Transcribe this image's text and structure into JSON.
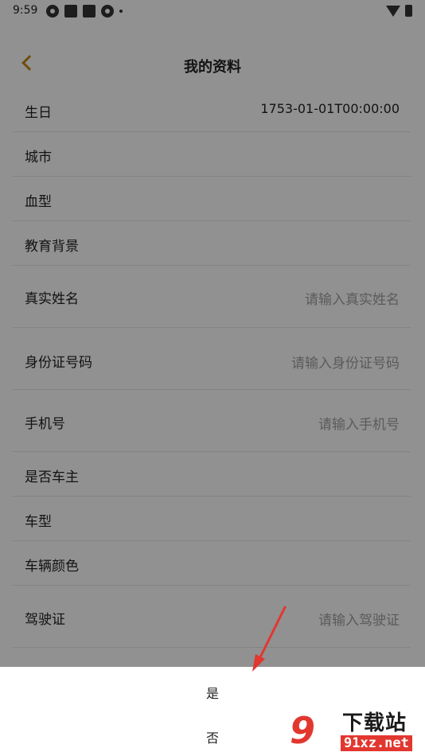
{
  "status_bar": {
    "time": "9:59"
  },
  "header": {
    "title": "我的资料"
  },
  "rows": [
    {
      "label": "生日",
      "value": "1753-01-01T00:00:00",
      "placeholder": ""
    },
    {
      "label": "城市",
      "value": "",
      "placeholder": ""
    },
    {
      "label": "血型",
      "value": "",
      "placeholder": ""
    },
    {
      "label": "教育背景",
      "value": "",
      "placeholder": ""
    },
    {
      "label": "真实姓名",
      "value": "",
      "placeholder": "请输入真实姓名"
    },
    {
      "label": "身份证号码",
      "value": "",
      "placeholder": "请输入身份证号码"
    },
    {
      "label": "手机号",
      "value": "",
      "placeholder": "请输入手机号"
    },
    {
      "label": "是否车主",
      "value": "",
      "placeholder": ""
    },
    {
      "label": "车型",
      "value": "",
      "placeholder": ""
    },
    {
      "label": "车辆颜色",
      "value": "",
      "placeholder": ""
    },
    {
      "label": "驾驶证",
      "value": "",
      "placeholder": "请输入驾驶证"
    }
  ],
  "sheet": {
    "options": [
      "是",
      "否"
    ]
  },
  "watermark": {
    "logo": "9",
    "title": "下载站",
    "url": "91xz.net"
  },
  "colors": {
    "accent": "#c58a16",
    "annotation": "#e2372f"
  }
}
